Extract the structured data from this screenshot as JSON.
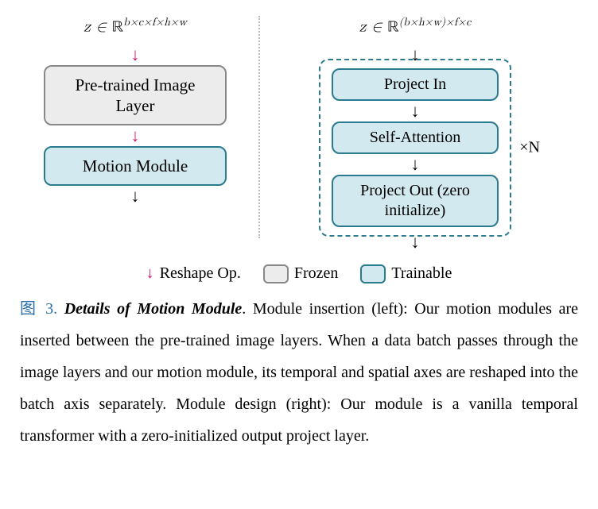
{
  "left": {
    "math_html": "<span style='font-style:italic'>z</span> ∈ <span class='bb'>ℝ</span><sup>b×c×f×h×w</sup>",
    "box1": "Pre-trained Image Layer",
    "box2": "Motion Module"
  },
  "right": {
    "math_html": "<span style='font-style:italic'>z</span> ∈ <span class='bb'>ℝ</span><sup>(b×h×w)×f×c</sup>",
    "b1": "Project In",
    "b2": "Self-Attention",
    "b3": "Project Out (zero initialize)",
    "xn": "×N"
  },
  "legend": {
    "reshape": "Reshape Op.",
    "frozen": "Frozen",
    "trainable": "Trainable"
  },
  "caption": {
    "label": "图 3.",
    "title": "Details of Motion Module",
    "body": ". Module insertion (left): Our motion modules are inserted between the pre-trained image layers. When a data batch passes through the image layers and our motion module, its temporal and spatial axes are reshaped into the batch axis separately. Module design (right): Our module is a vanilla temporal transformer with a zero-initialized output project layer."
  }
}
